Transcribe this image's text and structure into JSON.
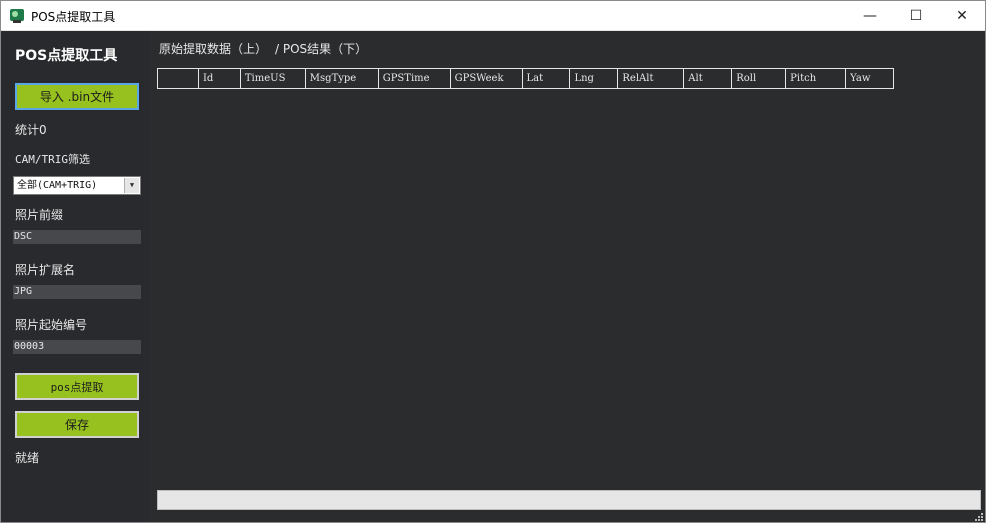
{
  "window": {
    "title": "POS点提取工具",
    "controls": {
      "minimize": "—",
      "maximize": "☐",
      "close": "✕"
    }
  },
  "sidebar": {
    "title": "POS点提取工具",
    "import_button": "导入 .bin文件",
    "stats": "统计0",
    "filter_label": "CAM/TRIG筛选",
    "filter_selected": "全部(CAM+TRIG)",
    "prefix_label": "照片前缀",
    "prefix_value": "DSC",
    "ext_label": "照片扩展名",
    "ext_value": "JPG",
    "start_label": "照片起始编号",
    "start_value": "00003",
    "extract_button": "pos点提取",
    "save_button": "保存",
    "status": "就绪"
  },
  "main": {
    "section_header": "原始提取数据（上）",
    "section_header_2": "/ POS结果（下）",
    "columns": [
      "",
      "Id",
      "TimeUS",
      "MsgType",
      "GPSTime",
      "GPSWeek",
      "Lat",
      "Lng",
      "RelAlt",
      "Alt",
      "Roll",
      "Pitch",
      "Yaw"
    ],
    "progress": 0
  },
  "colors": {
    "accent_green": "#96c11f",
    "background": "#2b2c2e",
    "text": "#e8e8e8"
  }
}
